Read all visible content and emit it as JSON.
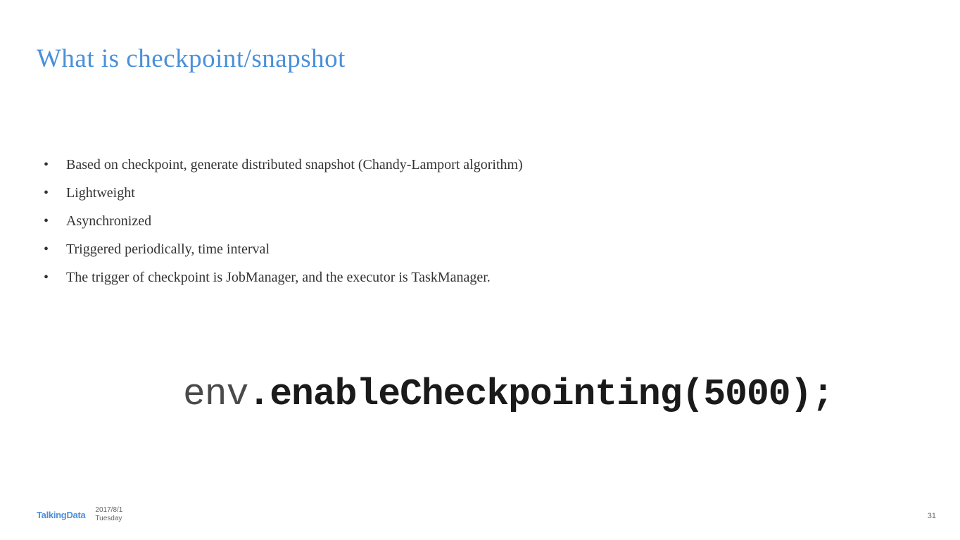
{
  "slide": {
    "title": "What is checkpoint/snapshot",
    "bullets": [
      "Based on checkpoint, generate distributed snapshot (Chandy-Lamport algorithm)",
      "Lightweight",
      "Asynchronized",
      "Triggered periodically, time interval",
      "The trigger of  checkpoint is JobManager, and the executor is TaskManager."
    ],
    "code": {
      "env": "env",
      "dot": ".",
      "method": "enableCheckpointing(5000);"
    }
  },
  "footer": {
    "logo": "TalkingData",
    "date": "2017/8/1",
    "day": "Tuesday"
  },
  "page_number": "31"
}
